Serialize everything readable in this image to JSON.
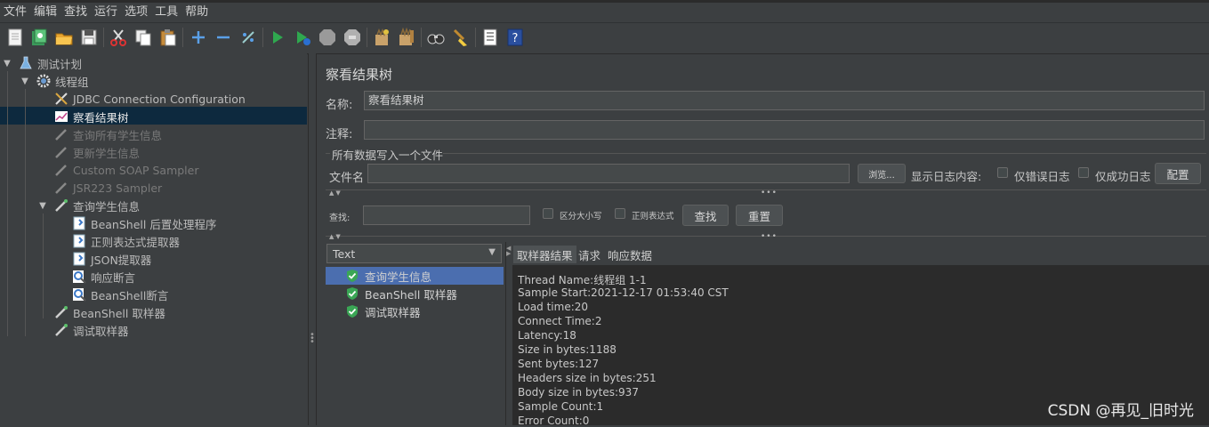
{
  "menu": [
    "文件",
    "编辑",
    "查找",
    "运行",
    "选项",
    "工具",
    "帮助"
  ],
  "toolbar_icons": [
    "new-icon",
    "templates-icon",
    "open-icon",
    "save-icon",
    "cut-icon",
    "copy-icon",
    "paste-icon",
    "expand-icon",
    "collapse-icon",
    "toggle-icon",
    "start-icon",
    "start-no-pause-icon",
    "stop-icon",
    "shutdown-icon",
    "clear-icon",
    "clear-all-icon",
    "search-icon",
    "reset-search-icon",
    "function-helper-icon",
    "help-icon"
  ],
  "tree": {
    "root": "测试计划",
    "thread_group": "线程组",
    "items": {
      "jdbc": "JDBC Connection Configuration",
      "view_results_tree": "察看结果树",
      "query_all": "查询所有学生信息",
      "update": "更新学生信息",
      "soap": "Custom SOAP Sampler",
      "jsr223": "JSR223 Sampler",
      "query_student": "查询学生信息",
      "beanshell_post": "BeanShell 后置处理程序",
      "regex": "正则表达式提取器",
      "json": "JSON提取器",
      "resp_assert": "响应断言",
      "bs_assert": "BeanShell断言",
      "bs_sampler": "BeanShell 取样器",
      "debug_sampler": "调试取样器"
    }
  },
  "panel": {
    "title": "察看结果树",
    "name_label": "名称:",
    "name_value": "察看结果树",
    "comment_label": "注释:",
    "comment_value": "",
    "file_section": "所有数据写入一个文件",
    "filename_label": "文件名",
    "filename_value": "",
    "browse": "浏览...",
    "log_label": "显示日志内容:",
    "errors_only": "仅错误日志",
    "success_only": "仅成功日志",
    "configure": "配置",
    "search_label": "查找:",
    "search_value": "",
    "case_sensitive": "区分大小写",
    "regex": "正则表达式",
    "find_btn": "查找",
    "reset_btn": "重置",
    "renderer": "Text"
  },
  "results": [
    "查询学生信息",
    "BeanShell 取样器",
    "调试取样器"
  ],
  "tabs": [
    "取样器结果",
    "请求",
    "响应数据"
  ],
  "details": [
    "Thread Name:线程组 1-1",
    "Sample Start:2021-12-17 01:53:40 CST",
    "Load time:20",
    "Connect Time:2",
    "Latency:18",
    "Size in bytes:1188",
    "Sent bytes:127",
    "Headers size in bytes:251",
    "Body size in bytes:937",
    "Sample Count:1",
    "Error Count:0"
  ],
  "watermark": "CSDN @再见_旧时光"
}
